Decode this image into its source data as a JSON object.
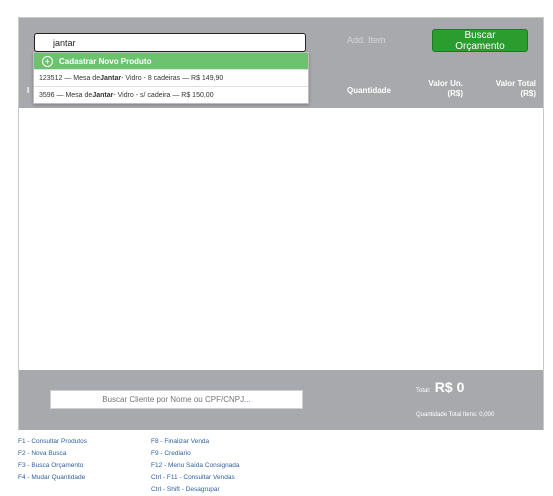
{
  "search": {
    "value": "jantar"
  },
  "toolbar": {
    "add_item": "Add. Item",
    "buscar_orcamento": "Buscar Orçamento"
  },
  "dropdown": {
    "new_product": {
      "icon": "plus-circle-icon",
      "label": "Cadastrar Novo Produto"
    },
    "items": [
      {
        "prefix": "123512 — Mesa de ",
        "highlight": "Jantar",
        "suffix": " - Vidro - 8 cadeiras — R$ 149,90"
      },
      {
        "prefix": "3596 — Mesa de ",
        "highlight": "Jantar",
        "suffix": " - Vidro - s/ cadeira — R$ 150,00"
      }
    ]
  },
  "table": {
    "header_fragment": "I",
    "columns": {
      "quantity": "Quantidade",
      "unit_value_line1": "Valor Un.",
      "unit_value_line2": "(R$)",
      "total_value_line1": "Valor Total",
      "total_value_line2": "(R$)"
    }
  },
  "footer": {
    "client_search_placeholder": "Buscar Cliente por Nome ou CPF/CNPJ...",
    "total_label": "Total:",
    "total_value": "R$ 0",
    "quantity_total": "Quantidade Total Itens: 0,000"
  },
  "shortcuts": {
    "left": [
      "F1 - Consultar Produtos",
      "F2 - Nova Busca",
      "F3 - Busca Orçamento",
      "F4 - Mudar Quantidade"
    ],
    "right": [
      "F8 - Finalizar Venda",
      "F9 - Crediario",
      "F12 - Menu Saída Consignada",
      "Ctrl - F11 - Consultar Vendas",
      "Ctrl - Shift - Desagrupar"
    ]
  }
}
